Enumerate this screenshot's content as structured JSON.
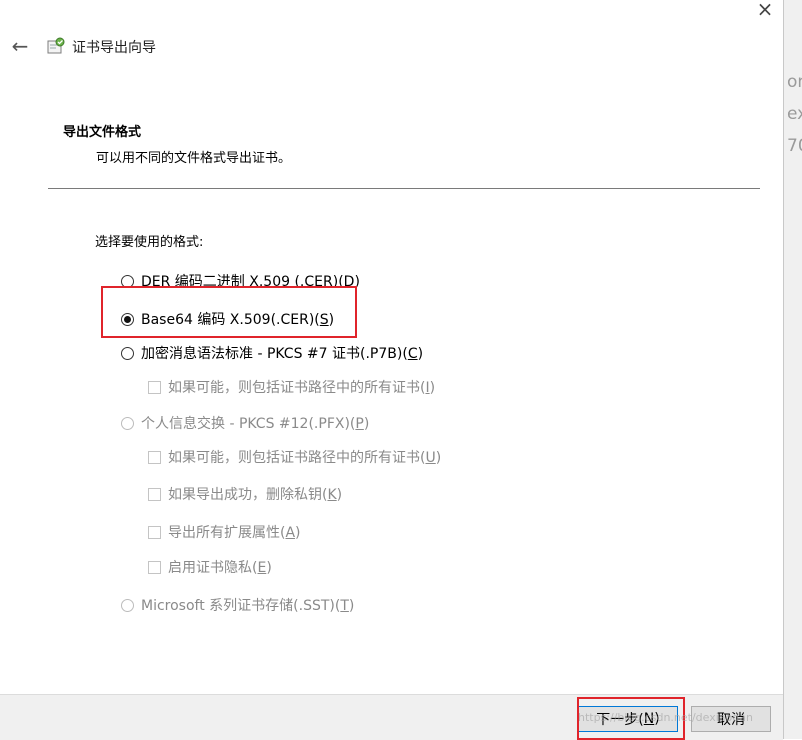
{
  "window": {
    "close_glyph": "×",
    "back_glyph": "←",
    "title": "证书导出向导"
  },
  "section": {
    "title": "导出文件格式",
    "description": "可以用不同的文件格式导出证书。"
  },
  "choose_label": "选择要使用的格式:",
  "options": [
    {
      "text": "DER 编码二进制 X.509 (.CER)(",
      "key": "D",
      "end": ")"
    },
    {
      "text": "Base64 编码 X.509(.CER)(",
      "key": "S",
      "end": ")"
    },
    {
      "text": "加密消息语法标准 - PKCS #7 证书(.P7B)(",
      "key": "C",
      "end": ")"
    },
    {
      "text": "个人信息交换 - PKCS #12(.PFX)(",
      "key": "P",
      "end": ")"
    },
    {
      "text": "Microsoft 系列证书存储(.SST)(",
      "key": "T",
      "end": ")"
    }
  ],
  "checkboxes": [
    {
      "text": "如果可能，则包括证书路径中的所有证书(",
      "key": "I",
      "end": ")"
    },
    {
      "text": "如果可能，则包括证书路径中的所有证书(",
      "key": "U",
      "end": ")"
    },
    {
      "text": "如果导出成功，删除私钥(",
      "key": "K",
      "end": ")"
    },
    {
      "text": "导出所有扩展属性(",
      "key": "A",
      "end": ")"
    },
    {
      "text": "启用证书隐私(",
      "key": "E",
      "end": ")"
    }
  ],
  "buttons": {
    "next": {
      "text": "下一步(",
      "key": "N",
      "end": ")"
    },
    "cancel": "取消"
  },
  "right_strip": [
    "on",
    "ex",
    "70"
  ],
  "watermark": "https://blog.csdn.net/dexiaodan",
  "colors": {
    "highlight": "#e0242b",
    "primary_border": "#0078d7",
    "footer_bg": "#f0f0f0"
  }
}
